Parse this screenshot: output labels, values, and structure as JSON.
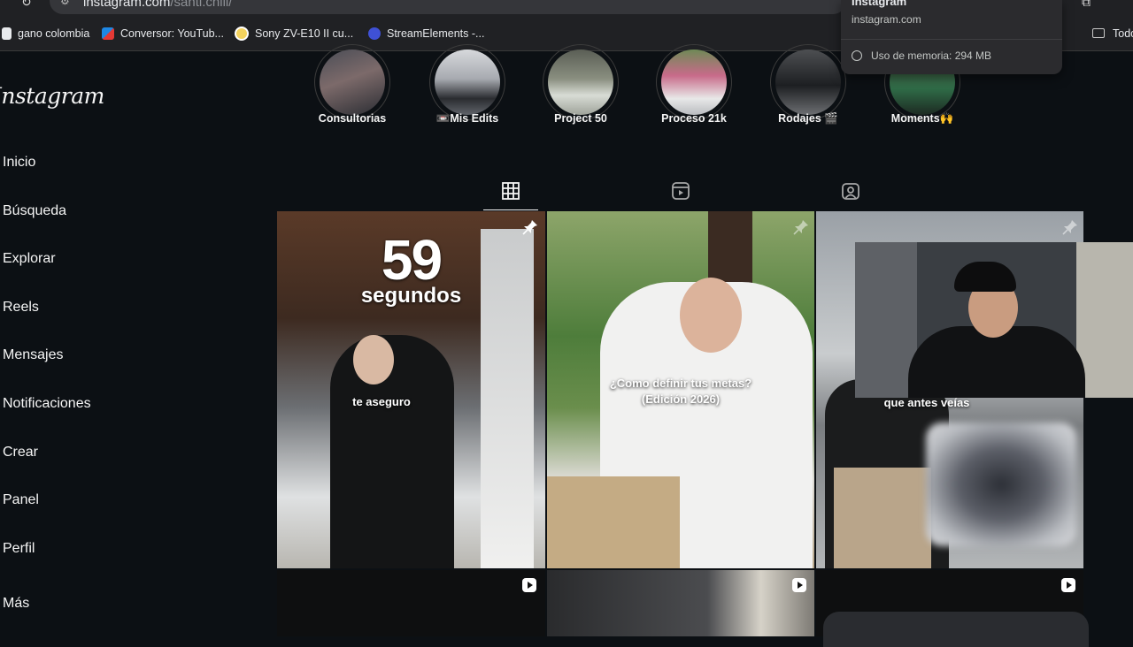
{
  "browser": {
    "url_host": "instagram.com",
    "url_path": "/santi.chili/",
    "bookmarks": [
      {
        "label": "gano colombia",
        "icon": "page-icon",
        "color": "#e8eaed"
      },
      {
        "label": "Conversor: YouTub...",
        "icon": "youtube-converter-icon",
        "color": "#e53935"
      },
      {
        "label": "Sony ZV-E10 II cu...",
        "icon": "sony-icon",
        "color": "#f4d35e"
      },
      {
        "label": "StreamElements -...",
        "icon": "streamelements-icon",
        "color": "#3f51d6"
      }
    ],
    "bookmarks_folder": "Todo"
  },
  "tab_hover_card": {
    "title": "Instagram",
    "domain": "instagram.com",
    "memory": "Uso de memoria: 294 MB"
  },
  "sidebar": {
    "logo": "Instagram",
    "items": [
      {
        "label": "Inicio"
      },
      {
        "label": "Búsqueda"
      },
      {
        "label": "Explorar"
      },
      {
        "label": "Reels"
      },
      {
        "label": "Mensajes"
      },
      {
        "label": "Notificaciones"
      },
      {
        "label": "Crear"
      },
      {
        "label": "Panel"
      },
      {
        "label": "Perfil"
      },
      {
        "label": "Más"
      }
    ]
  },
  "highlights": [
    {
      "label": "Consultorias"
    },
    {
      "label": "📼Mis Edits"
    },
    {
      "label": "Project 50"
    },
    {
      "label": "Proceso 21k"
    },
    {
      "label": "Rodajes 🎬"
    },
    {
      "label": "Moments🙌"
    }
  ],
  "profile_tabs": [
    {
      "name": "posts",
      "icon": "grid-icon",
      "active": true
    },
    {
      "name": "reels",
      "icon": "reels-icon",
      "active": false
    },
    {
      "name": "tagged",
      "icon": "tagged-icon",
      "active": false
    }
  ],
  "posts": [
    {
      "caption_big": "59",
      "caption_sub": "segundos",
      "caption_lower": "te aseguro",
      "pinned": true
    },
    {
      "caption_lower": "¿Como definir tus metas?\n(Edición 2026)",
      "pinned": true
    },
    {
      "caption_lower": "que antes veías",
      "pinned": true
    },
    {
      "caption_lower": "",
      "reel": true
    },
    {
      "caption_lower": "",
      "reel": true
    },
    {
      "caption_lower": "",
      "reel": true
    }
  ],
  "colors": {
    "background": "#0c1014",
    "text": "#f5f5f5",
    "chrome": "#202124"
  }
}
